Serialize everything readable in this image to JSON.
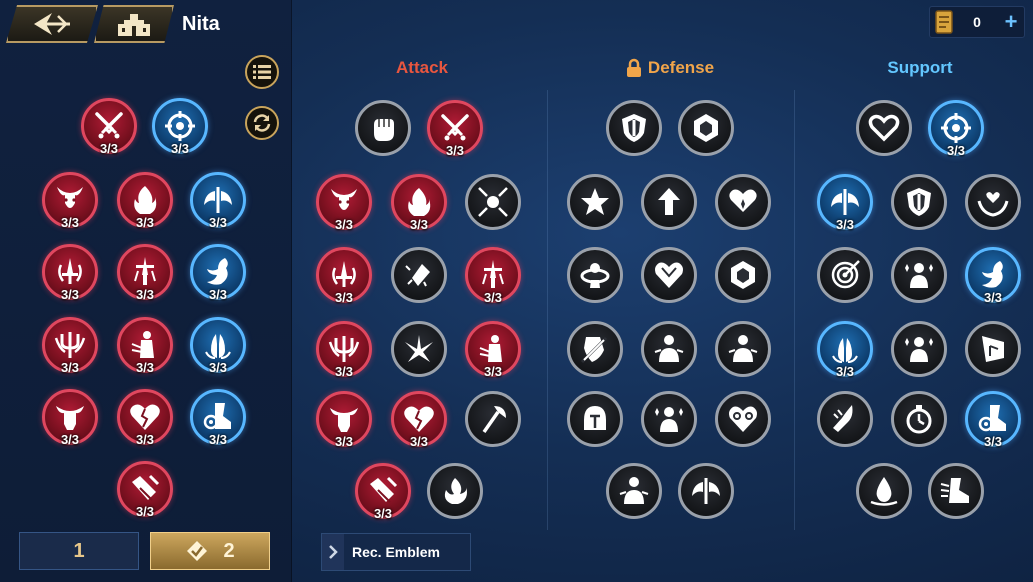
{
  "header": {
    "hero_name": "Nita",
    "currency_amount": "0",
    "back_icon": "back-arrow-icon",
    "home_icon": "castle-icon"
  },
  "columns": {
    "attack": "Attack",
    "defense": "Defense",
    "support": "Support"
  },
  "colors": {
    "attack_title": "#e8563f",
    "defense_title": "#f1a54a",
    "support_title": "#63c7ff",
    "attack_ring": "#e0475f",
    "support_ring": "#58b7ff"
  },
  "counts": {
    "left_c1": "3/3",
    "left_c2": "3/3",
    "left_r2_1": "3/3",
    "left_r2_2": "3/3",
    "left_r2_3": "3/3",
    "left_r3_1": "3/3",
    "left_r3_2": "3/3",
    "left_r3_3": "3/3",
    "left_r4_1": "3/3",
    "left_r4_2": "3/3",
    "left_r4_3": "3/3",
    "left_r5_1": "3/3",
    "left_r5_2": "3/3",
    "left_r5_3": "3/3",
    "left_r6_1": "3/3",
    "atk_r1_2": "3/3",
    "atk_r2_1": "3/3",
    "atk_r2_2": "3/3",
    "atk_r3_1": "3/3",
    "atk_r3_3": "3/3",
    "atk_r4_1": "3/3",
    "atk_r4_3": "3/3",
    "atk_r5_1": "3/3",
    "atk_r5_2": "3/3",
    "atk_r6_1": "3/3",
    "sup_r1_2": "3/3",
    "sup_r2_1": "3/3",
    "sup_r3_3": "3/3",
    "sup_r4_1": "3/3",
    "sup_r5_3": "3/3"
  },
  "tabs": {
    "tab1": "1",
    "tab2": "2"
  },
  "recommended": "Rec. Emblem"
}
